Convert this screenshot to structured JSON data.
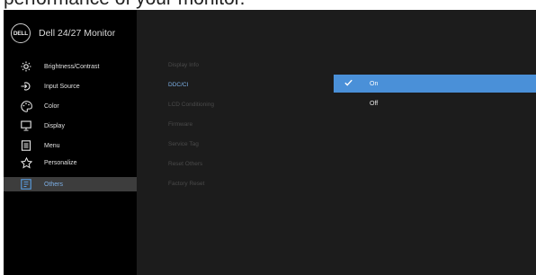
{
  "caption": "performance of your monitor.",
  "brand": {
    "logo_text": "DELL",
    "title": "Dell 24/27 Monitor"
  },
  "menu": [
    {
      "label": "Brightness/Contrast",
      "icon": "brightness-icon"
    },
    {
      "label": "Input Source",
      "icon": "input-source-icon"
    },
    {
      "label": "Color",
      "icon": "color-icon"
    },
    {
      "label": "Display",
      "icon": "display-icon"
    },
    {
      "label": "Menu",
      "icon": "menu-icon"
    },
    {
      "label": "Personalize",
      "icon": "star-icon"
    },
    {
      "label": "Others",
      "icon": "others-icon",
      "active": true
    }
  ],
  "submenu": [
    "Display Info",
    "DDC/CI",
    "LCD Conditioning",
    "Firmware",
    "Service Tag",
    "Reset Others",
    "Factory Reset"
  ],
  "submenu_selected": "DDC/CI",
  "options": [
    {
      "label": "On",
      "selected": true
    },
    {
      "label": "Off",
      "selected": false
    }
  ],
  "colors": {
    "accent": "#4a90d8",
    "active_text": "#7db0e6",
    "sidebar_bg": "#000000",
    "panel_bg": "#1c1c1c"
  }
}
